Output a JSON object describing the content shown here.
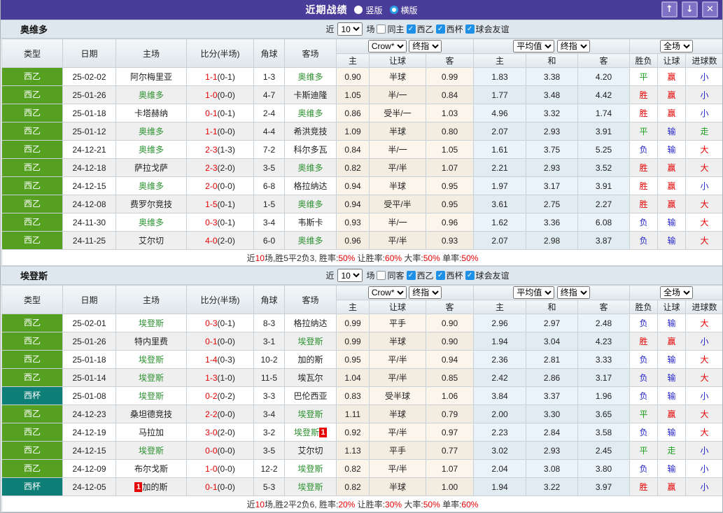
{
  "header": {
    "title": "近期战绩",
    "radio_vertical": "竖版",
    "radio_horizontal": "横版",
    "buttons": {
      "up": "↑",
      "down": "↓",
      "close": "✕"
    }
  },
  "filters": {
    "near_label": "近",
    "count_value": "10",
    "matches_label": "场",
    "league_label": "西乙",
    "cup_label": "西杯",
    "friendly_label": "球会友谊"
  },
  "dropdowns": {
    "bookmaker": "Crow*",
    "final1": "终指",
    "average": "平均值",
    "final2": "终指",
    "full": "全场"
  },
  "columns": {
    "type": "类型",
    "date": "日期",
    "home": "主场",
    "score": "比分(半场)",
    "corner": "角球",
    "away": "客场",
    "odds_home": "主",
    "handicap": "让球",
    "odds_away": "客",
    "avg_home": "主",
    "avg_draw": "和",
    "avg_away": "客",
    "result": "胜负",
    "handicap_result": "让球",
    "goals": "进球数"
  },
  "colors": {
    "titlebar_bg": "#4a3d9a",
    "league_bg": {
      "西乙": "#56a021",
      "西杯": "#0e7f76"
    },
    "team_highlight": "#2e9331",
    "score_red": "#e60000",
    "checkbox_blue": "#1e90e8",
    "result": {
      "胜": "#e60000",
      "平": "#1ca01c",
      "负": "#2525cd",
      "赢": "#e60000",
      "输": "#2525cd",
      "走": "#1ca01c",
      "大": "#e60000",
      "小": "#2525cd"
    }
  },
  "teams": [
    {
      "name": "奥维多",
      "same_label": "同主",
      "rows": [
        {
          "type": "西乙",
          "date": "25-02-02",
          "home": "阿尔梅里亚",
          "hg": false,
          "hbadge": "",
          "ft": "1-1",
          "ht": "0-1",
          "corner": "1-3",
          "away": "奥维多",
          "ag": true,
          "abadge": "",
          "o1": "0.90",
          "hcap": "半球",
          "o2": "0.99",
          "a1": "1.83",
          "a2": "3.38",
          "a3": "4.20",
          "r1": "平",
          "r2": "赢",
          "r3": "小"
        },
        {
          "type": "西乙",
          "date": "25-01-26",
          "home": "奥维多",
          "hg": true,
          "hbadge": "",
          "ft": "1-0",
          "ht": "0-0",
          "corner": "4-7",
          "away": "卡斯迪隆",
          "ag": false,
          "abadge": "",
          "o1": "1.05",
          "hcap": "半/一",
          "o2": "0.84",
          "a1": "1.77",
          "a2": "3.48",
          "a3": "4.42",
          "r1": "胜",
          "r2": "赢",
          "r3": "小"
        },
        {
          "type": "西乙",
          "date": "25-01-18",
          "home": "卡塔赫纳",
          "hg": false,
          "hbadge": "",
          "ft": "0-1",
          "ht": "0-1",
          "corner": "2-4",
          "away": "奥维多",
          "ag": true,
          "abadge": "",
          "o1": "0.86",
          "hcap": "受半/一",
          "o2": "1.03",
          "a1": "4.96",
          "a2": "3.32",
          "a3": "1.74",
          "r1": "胜",
          "r2": "赢",
          "r3": "小"
        },
        {
          "type": "西乙",
          "date": "25-01-12",
          "home": "奥维多",
          "hg": true,
          "hbadge": "",
          "ft": "1-1",
          "ht": "0-0",
          "corner": "4-4",
          "away": "希洪竞技",
          "ag": false,
          "abadge": "",
          "o1": "1.09",
          "hcap": "半球",
          "o2": "0.80",
          "a1": "2.07",
          "a2": "2.93",
          "a3": "3.91",
          "r1": "平",
          "r2": "输",
          "r3": "走"
        },
        {
          "type": "西乙",
          "date": "24-12-21",
          "home": "奥维多",
          "hg": true,
          "hbadge": "",
          "ft": "2-3",
          "ht": "1-3",
          "corner": "7-2",
          "away": "科尔多瓦",
          "ag": false,
          "abadge": "",
          "o1": "0.84",
          "hcap": "半/一",
          "o2": "1.05",
          "a1": "1.61",
          "a2": "3.75",
          "a3": "5.25",
          "r1": "负",
          "r2": "输",
          "r3": "大"
        },
        {
          "type": "西乙",
          "date": "24-12-18",
          "home": "萨拉戈萨",
          "hg": false,
          "hbadge": "",
          "ft": "2-3",
          "ht": "2-0",
          "corner": "3-5",
          "away": "奥维多",
          "ag": true,
          "abadge": "",
          "o1": "0.82",
          "hcap": "平/半",
          "o2": "1.07",
          "a1": "2.21",
          "a2": "2.93",
          "a3": "3.52",
          "r1": "胜",
          "r2": "赢",
          "r3": "大"
        },
        {
          "type": "西乙",
          "date": "24-12-15",
          "home": "奥维多",
          "hg": true,
          "hbadge": "",
          "ft": "2-0",
          "ht": "0-0",
          "corner": "6-8",
          "away": "格拉纳达",
          "ag": false,
          "abadge": "",
          "o1": "0.94",
          "hcap": "半球",
          "o2": "0.95",
          "a1": "1.97",
          "a2": "3.17",
          "a3": "3.91",
          "r1": "胜",
          "r2": "赢",
          "r3": "小"
        },
        {
          "type": "西乙",
          "date": "24-12-08",
          "home": "费罗尔竞技",
          "hg": false,
          "hbadge": "",
          "ft": "1-5",
          "ht": "0-1",
          "corner": "1-5",
          "away": "奥维多",
          "ag": true,
          "abadge": "",
          "o1": "0.94",
          "hcap": "受平/半",
          "o2": "0.95",
          "a1": "3.61",
          "a2": "2.75",
          "a3": "2.27",
          "r1": "胜",
          "r2": "赢",
          "r3": "大"
        },
        {
          "type": "西乙",
          "date": "24-11-30",
          "home": "奥维多",
          "hg": true,
          "hbadge": "",
          "ft": "0-3",
          "ht": "0-1",
          "corner": "3-4",
          "away": "韦斯卡",
          "ag": false,
          "abadge": "",
          "o1": "0.93",
          "hcap": "半/一",
          "o2": "0.96",
          "a1": "1.62",
          "a2": "3.36",
          "a3": "6.08",
          "r1": "负",
          "r2": "输",
          "r3": "大"
        },
        {
          "type": "西乙",
          "date": "24-11-25",
          "home": "艾尔切",
          "hg": false,
          "hbadge": "",
          "ft": "4-0",
          "ht": "2-0",
          "corner": "6-0",
          "away": "奥维多",
          "ag": true,
          "abadge": "",
          "o1": "0.96",
          "hcap": "平/半",
          "o2": "0.93",
          "a1": "2.07",
          "a2": "2.98",
          "a3": "3.87",
          "r1": "负",
          "r2": "输",
          "r3": "大"
        }
      ],
      "summary": [
        [
          "近",
          0
        ],
        [
          "10",
          1
        ],
        [
          "场,胜5平2负3, 胜率:",
          0
        ],
        [
          "50%",
          1
        ],
        [
          " 让胜率:",
          0
        ],
        [
          "60%",
          1
        ],
        [
          " 大率:",
          0
        ],
        [
          "50%",
          1
        ],
        [
          " 单率:",
          0
        ],
        [
          "50%",
          1
        ]
      ]
    },
    {
      "name": "埃登斯",
      "same_label": "同客",
      "rows": [
        {
          "type": "西乙",
          "date": "25-02-01",
          "home": "埃登斯",
          "hg": true,
          "hbadge": "",
          "ft": "0-3",
          "ht": "0-1",
          "corner": "8-3",
          "away": "格拉纳达",
          "ag": false,
          "abadge": "",
          "o1": "0.99",
          "hcap": "平手",
          "o2": "0.90",
          "a1": "2.96",
          "a2": "2.97",
          "a3": "2.48",
          "r1": "负",
          "r2": "输",
          "r3": "大"
        },
        {
          "type": "西乙",
          "date": "25-01-26",
          "home": "特内里费",
          "hg": false,
          "hbadge": "",
          "ft": "0-1",
          "ht": "0-0",
          "corner": "3-1",
          "away": "埃登斯",
          "ag": true,
          "abadge": "",
          "o1": "0.99",
          "hcap": "半球",
          "o2": "0.90",
          "a1": "1.94",
          "a2": "3.04",
          "a3": "4.23",
          "r1": "胜",
          "r2": "赢",
          "r3": "小"
        },
        {
          "type": "西乙",
          "date": "25-01-18",
          "home": "埃登斯",
          "hg": true,
          "hbadge": "",
          "ft": "1-4",
          "ht": "0-3",
          "corner": "10-2",
          "away": "加的斯",
          "ag": false,
          "abadge": "",
          "o1": "0.95",
          "hcap": "平/半",
          "o2": "0.94",
          "a1": "2.36",
          "a2": "2.81",
          "a3": "3.33",
          "r1": "负",
          "r2": "输",
          "r3": "大"
        },
        {
          "type": "西乙",
          "date": "25-01-14",
          "home": "埃登斯",
          "hg": true,
          "hbadge": "",
          "ft": "1-3",
          "ht": "1-0",
          "corner": "11-5",
          "away": "埃瓦尔",
          "ag": false,
          "abadge": "",
          "o1": "1.04",
          "hcap": "平/半",
          "o2": "0.85",
          "a1": "2.42",
          "a2": "2.86",
          "a3": "3.17",
          "r1": "负",
          "r2": "输",
          "r3": "大"
        },
        {
          "type": "西杯",
          "date": "25-01-08",
          "home": "埃登斯",
          "hg": true,
          "hbadge": "",
          "ft": "0-2",
          "ht": "0-2",
          "corner": "3-3",
          "away": "巴伦西亚",
          "ag": false,
          "abadge": "",
          "o1": "0.83",
          "hcap": "受半球",
          "o2": "1.06",
          "a1": "3.84",
          "a2": "3.37",
          "a3": "1.96",
          "r1": "负",
          "r2": "输",
          "r3": "小"
        },
        {
          "type": "西乙",
          "date": "24-12-23",
          "home": "桑坦德竞技",
          "hg": false,
          "hbadge": "",
          "ft": "2-2",
          "ht": "0-0",
          "corner": "3-4",
          "away": "埃登斯",
          "ag": true,
          "abadge": "",
          "o1": "1.11",
          "hcap": "半球",
          "o2": "0.79",
          "a1": "2.00",
          "a2": "3.30",
          "a3": "3.65",
          "r1": "平",
          "r2": "赢",
          "r3": "大"
        },
        {
          "type": "西乙",
          "date": "24-12-19",
          "home": "马拉加",
          "hg": false,
          "hbadge": "",
          "ft": "3-0",
          "ht": "2-0",
          "corner": "3-2",
          "away": "埃登斯",
          "ag": true,
          "abadge": "1",
          "o1": "0.92",
          "hcap": "平/半",
          "o2": "0.97",
          "a1": "2.23",
          "a2": "2.84",
          "a3": "3.58",
          "r1": "负",
          "r2": "输",
          "r3": "大"
        },
        {
          "type": "西乙",
          "date": "24-12-15",
          "home": "埃登斯",
          "hg": true,
          "hbadge": "",
          "ft": "0-0",
          "ht": "0-0",
          "corner": "3-5",
          "away": "艾尔切",
          "ag": false,
          "abadge": "",
          "o1": "1.13",
          "hcap": "平手",
          "o2": "0.77",
          "a1": "3.02",
          "a2": "2.93",
          "a3": "2.45",
          "r1": "平",
          "r2": "走",
          "r3": "小"
        },
        {
          "type": "西乙",
          "date": "24-12-09",
          "home": "布尔戈斯",
          "hg": false,
          "hbadge": "",
          "ft": "1-0",
          "ht": "0-0",
          "corner": "12-2",
          "away": "埃登斯",
          "ag": true,
          "abadge": "",
          "o1": "0.82",
          "hcap": "平/半",
          "o2": "1.07",
          "a1": "2.04",
          "a2": "3.08",
          "a3": "3.80",
          "r1": "负",
          "r2": "输",
          "r3": "小"
        },
        {
          "type": "西杯",
          "date": "24-12-05",
          "home": "加的斯",
          "hg": false,
          "hbadge": "1",
          "ft": "0-1",
          "ht": "0-0",
          "corner": "5-3",
          "away": "埃登斯",
          "ag": true,
          "abadge": "",
          "o1": "0.82",
          "hcap": "半球",
          "o2": "1.00",
          "a1": "1.94",
          "a2": "3.22",
          "a3": "3.97",
          "r1": "胜",
          "r2": "赢",
          "r3": "小"
        }
      ],
      "summary": [
        [
          "近",
          0
        ],
        [
          "10",
          1
        ],
        [
          "场,胜2平2负6, 胜率:",
          0
        ],
        [
          "20%",
          1
        ],
        [
          " 让胜率:",
          0
        ],
        [
          "30%",
          1
        ],
        [
          " 大率:",
          0
        ],
        [
          "50%",
          1
        ],
        [
          " 单率:",
          0
        ],
        [
          "60%",
          1
        ]
      ]
    }
  ]
}
